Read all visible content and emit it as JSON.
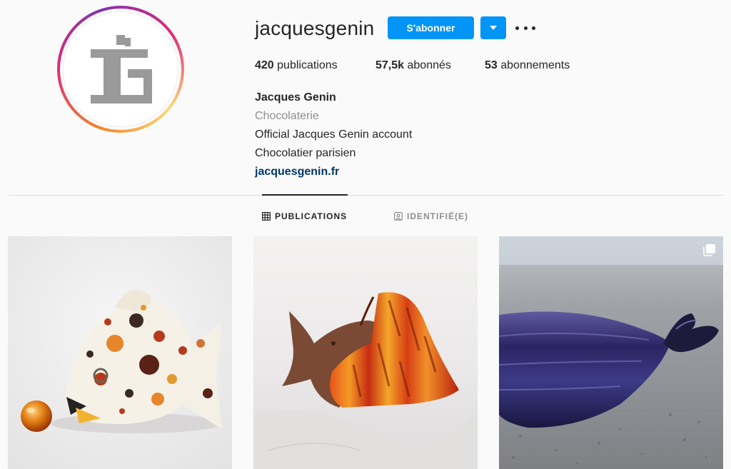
{
  "profile": {
    "username": "jacquesgenin",
    "follow_label": "S'abonner",
    "stats": [
      {
        "count": "420",
        "label": "publications"
      },
      {
        "count": "57,5k",
        "label": "abonnés"
      },
      {
        "count": "53",
        "label": "abonnements"
      }
    ],
    "bio": {
      "name": "Jacques Genin",
      "category": "Chocolaterie",
      "line1": "Official Jacques Genin account",
      "line2": "Chocolatier parisien",
      "website": "jacquesgenin.fr"
    }
  },
  "tabs": [
    {
      "label": "PUBLICATIONS",
      "icon": "grid-icon",
      "active": true
    },
    {
      "label": "IDENTIFIÉ(E)",
      "icon": "tagged-icon",
      "active": false
    }
  ],
  "posts": [
    {
      "subject": "painted chocolate fish with orange sphere",
      "icon": null
    },
    {
      "subject": "chocolate angel fish with orange and red stripes",
      "icon": null
    },
    {
      "subject": "dark blue glossy chocolate fish",
      "icon": "multiple-photos-icon"
    }
  ],
  "colors": {
    "accent": "#0095f6",
    "link": "#00376b",
    "muted": "#8e8e8e",
    "text": "#262626"
  }
}
